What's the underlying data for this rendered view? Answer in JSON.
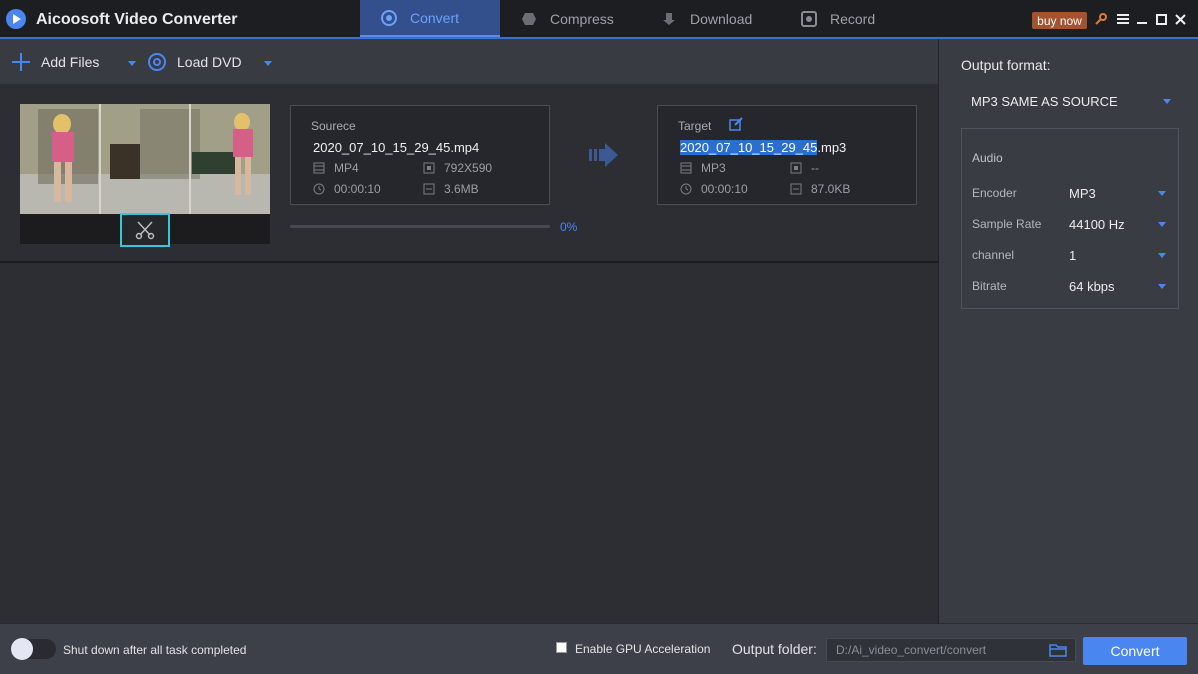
{
  "app": {
    "title": "Aicoosoft Video Converter"
  },
  "tabs": [
    {
      "label": "Convert",
      "active": true,
      "icon": "convert-icon"
    },
    {
      "label": "Compress",
      "active": false,
      "icon": "compress-icon"
    },
    {
      "label": "Download",
      "active": false,
      "icon": "download-icon"
    },
    {
      "label": "Record",
      "active": false,
      "icon": "record-icon"
    }
  ],
  "window": {
    "buy_label": "buy now",
    "icons": [
      "key-icon",
      "menu-icon",
      "minimize-icon",
      "maximize-icon",
      "close-icon"
    ]
  },
  "toolbar": {
    "add_files_label": "Add Files",
    "load_dvd_label": "Load DVD"
  },
  "task": {
    "source": {
      "label": "Sourece",
      "filename": "2020_07_10_15_29_45.mp4",
      "format": "MP4",
      "resolution": "792X590",
      "duration": "00:00:10",
      "size": "3.6MB"
    },
    "target": {
      "label": "Target",
      "filename_selected": "2020_07_10_15_29_45",
      "filename_ext": ".mp3",
      "format": "MP3",
      "resolution": "--",
      "duration": "00:00:10",
      "size": "87.0KB"
    },
    "progress_percent": 0,
    "progress_label": "0%"
  },
  "output": {
    "format_label": "Output format:",
    "format_value": "MP3 SAME AS SOURCE",
    "audio_title": "Audio",
    "settings": [
      {
        "key": "Encoder",
        "value": "MP3"
      },
      {
        "key": "Sample Rate",
        "value": "44100 Hz"
      },
      {
        "key": "channel",
        "value": "1"
      },
      {
        "key": "Bitrate",
        "value": "64 kbps"
      }
    ]
  },
  "bottom": {
    "shutdown_label": "Shut down after all task completed",
    "shutdown_enabled": false,
    "gpu_label": "Enable GPU Acceleration",
    "gpu_checked": false,
    "output_folder_label": "Output folder:",
    "output_folder_path": "D:/Ai_video_convert/convert",
    "convert_label": "Convert"
  },
  "colors": {
    "accent": "#4a86f0",
    "buy_now": "#a5522e",
    "trim_border": "#3ac8d8",
    "selection": "#2a6fcf"
  }
}
